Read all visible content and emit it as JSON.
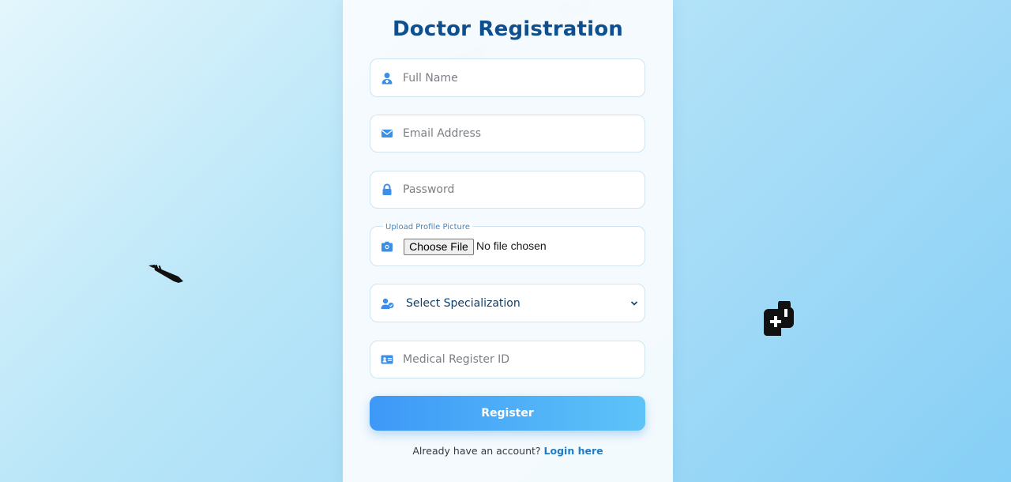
{
  "page": {
    "title": "Doctor Registration"
  },
  "form": {
    "full_name": {
      "placeholder": "Full Name",
      "icon": "user-doctor-icon"
    },
    "email": {
      "placeholder": "Email Address",
      "icon": "envelope-icon"
    },
    "password": {
      "placeholder": "Password",
      "icon": "lock-icon"
    },
    "upload": {
      "legend": "Upload Profile Picture",
      "button_label": "Choose File",
      "status": "No file chosen",
      "icon": "camera-icon"
    },
    "specialization": {
      "selected": "Select Specialization",
      "icon": "user-group-icon"
    },
    "register_id": {
      "placeholder": "Medical Register ID",
      "icon": "id-card-icon"
    },
    "submit_label": "Register"
  },
  "footer": {
    "prompt": "Already have an account?",
    "link_label": "Login here"
  },
  "colors": {
    "accent": "#3d98f7",
    "title": "#0d4f8f",
    "icon": "#3b8fe6",
    "link": "#1f7dc7"
  }
}
